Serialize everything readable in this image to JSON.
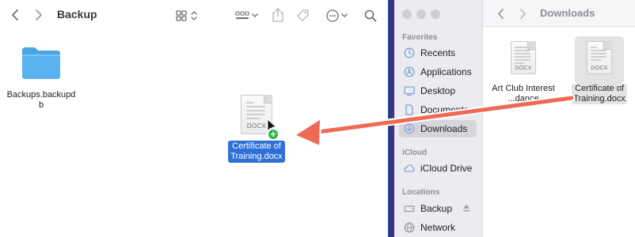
{
  "left_window": {
    "title": "Backup",
    "items": [
      {
        "name": "Backups.backupdb",
        "line1": "Backups.backupd",
        "line2": "b"
      }
    ],
    "dragged_file": {
      "line1": "Certificate of",
      "line2": "Training.docx",
      "ext": "DOCX"
    }
  },
  "right_window": {
    "title": "Downloads",
    "sidebar": {
      "favorites_header": "Favorites",
      "favorites": [
        {
          "label": "Recents",
          "icon": "clock-icon"
        },
        {
          "label": "Applications",
          "icon": "applications-icon"
        },
        {
          "label": "Desktop",
          "icon": "desktop-icon"
        },
        {
          "label": "Documents",
          "icon": "document-icon"
        },
        {
          "label": "Downloads",
          "icon": "download-icon",
          "active": true
        }
      ],
      "icloud_header": "iCloud",
      "icloud": [
        {
          "label": "iCloud Drive",
          "icon": "cloud-icon"
        }
      ],
      "locations_header": "Locations",
      "locations": [
        {
          "label": "Backup",
          "icon": "disk-icon",
          "eject": true
        },
        {
          "label": "Network",
          "icon": "globe-icon"
        }
      ]
    },
    "files": [
      {
        "line1": "Art Club Interest",
        "line2": "...dance",
        "ext": "DOCX"
      },
      {
        "line1": "Certificate of",
        "line2": "Training.docx",
        "ext": "DOCX",
        "selected": true
      }
    ]
  },
  "colors": {
    "selection_blue": "#2f6fd8",
    "arrow": "#ef6a55",
    "folder": "#5ab2ef",
    "plus_badge": "#2bb24c"
  }
}
